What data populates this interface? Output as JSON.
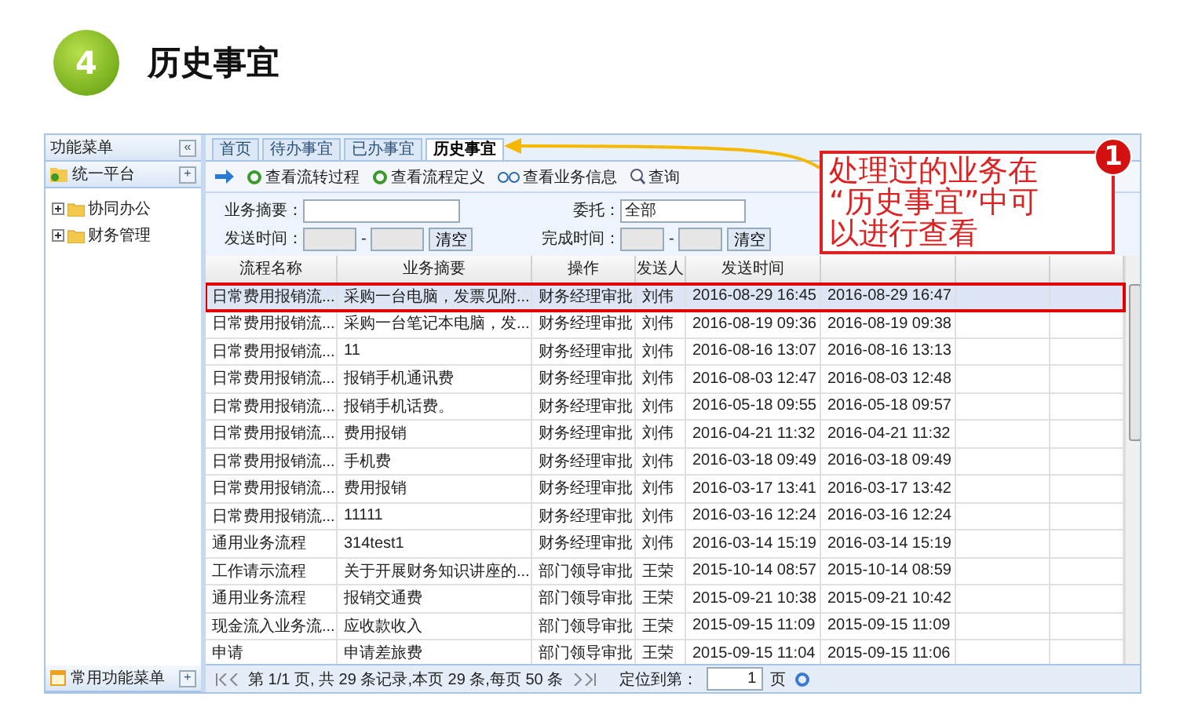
{
  "step": {
    "number": "4",
    "title": "历史事宜"
  },
  "sidebar": {
    "title": "功能菜单",
    "collapse": "«",
    "root": {
      "label": "统一平台",
      "add": "+"
    },
    "items": [
      {
        "label": "协同办公",
        "expanded": false
      },
      {
        "label": "财务管理",
        "expanded": false
      }
    ],
    "footer": {
      "label": "常用功能菜单",
      "add": "+"
    }
  },
  "tabs": [
    {
      "label": "首页",
      "selected": false
    },
    {
      "label": "待办事宜",
      "selected": false
    },
    {
      "label": "已办事宜",
      "selected": false
    },
    {
      "label": "历史事宜",
      "selected": true
    }
  ],
  "toolbar": [
    {
      "label": "查看流转过程",
      "kind": "cycle"
    },
    {
      "label": "查看流程定义",
      "kind": "cycle"
    },
    {
      "label": "查看业务信息",
      "kind": "glasses"
    },
    {
      "label": "查询",
      "kind": "search"
    }
  ],
  "filters": {
    "summary_label": "业务摘要：",
    "send_label": "发送时间：",
    "send_clear": "清空",
    "finish_clear": "清空",
    "delegate_label": "委托：",
    "delegate_value": "全部",
    "finish_label": "完成时间：",
    "dash": "-"
  },
  "table": {
    "columns": [
      "流程名称",
      "业务摘要",
      "操作",
      "发送人",
      "发送时间"
    ],
    "rows": [
      {
        "cells": [
          "日常费用报销流...",
          "采购一台电脑，发票见附...",
          "财务经理审批",
          "刘伟",
          "2016-08-29 16:45",
          "2016-08-29 16:47"
        ],
        "selected": true
      },
      {
        "cells": [
          "日常费用报销流...",
          "采购一台笔记本电脑，发...",
          "财务经理审批",
          "刘伟",
          "2016-08-19 09:36",
          "2016-08-19 09:38"
        ],
        "selected": false
      },
      {
        "cells": [
          "日常费用报销流...",
          "11",
          "财务经理审批",
          "刘伟",
          "2016-08-16 13:07",
          "2016-08-16 13:13"
        ],
        "selected": false
      },
      {
        "cells": [
          "日常费用报销流...",
          "报销手机通讯费",
          "财务经理审批",
          "刘伟",
          "2016-08-03 12:47",
          "2016-08-03 12:48"
        ],
        "selected": false
      },
      {
        "cells": [
          "日常费用报销流...",
          "报销手机话费。",
          "财务经理审批",
          "刘伟",
          "2016-05-18 09:55",
          "2016-05-18 09:57"
        ],
        "selected": false
      },
      {
        "cells": [
          "日常费用报销流...",
          "费用报销",
          "财务经理审批",
          "刘伟",
          "2016-04-21 11:32",
          "2016-04-21 11:32"
        ],
        "selected": false
      },
      {
        "cells": [
          "日常费用报销流...",
          "手机费",
          "财务经理审批",
          "刘伟",
          "2016-03-18 09:49",
          "2016-03-18 09:49"
        ],
        "selected": false
      },
      {
        "cells": [
          "日常费用报销流...",
          "费用报销",
          "财务经理审批",
          "刘伟",
          "2016-03-17 13:41",
          "2016-03-17 13:42"
        ],
        "selected": false
      },
      {
        "cells": [
          "日常费用报销流...",
          "11111",
          "财务经理审批",
          "刘伟",
          "2016-03-16 12:24",
          "2016-03-16 12:24"
        ],
        "selected": false
      },
      {
        "cells": [
          "通用业务流程",
          "314test1",
          "财务经理审批",
          "刘伟",
          "2016-03-14 15:19",
          "2016-03-14 15:19"
        ],
        "selected": false
      },
      {
        "cells": [
          "工作请示流程",
          "关于开展财务知识讲座的...",
          "部门领导审批",
          "王荣",
          "2015-10-14 08:57",
          "2015-10-14 08:59"
        ],
        "selected": false
      },
      {
        "cells": [
          "通用业务流程",
          "报销交通费",
          "部门领导审批",
          "王荣",
          "2015-09-21 10:38",
          "2015-09-21 10:42"
        ],
        "selected": false
      },
      {
        "cells": [
          "现金流入业务流...",
          "应收款收入",
          "部门领导审批",
          "王荣",
          "2015-09-15 11:09",
          "2015-09-15 11:09"
        ],
        "selected": false
      },
      {
        "cells": [
          "申请",
          "申请差旅费",
          "部门领导审批",
          "王荣",
          "2015-09-15 11:04",
          "2015-09-15 11:06"
        ],
        "selected": false
      }
    ]
  },
  "pager": {
    "info": "第 1/1 页, 共 29 条记录,本页 29 条,每页 50 条",
    "goto_label": "定位到第：",
    "page": "1",
    "page_unit": "页"
  },
  "callout": {
    "badge": "1",
    "lines": [
      "处理过的业务在",
      "“历史事宜”中可",
      "以进行查看"
    ]
  }
}
